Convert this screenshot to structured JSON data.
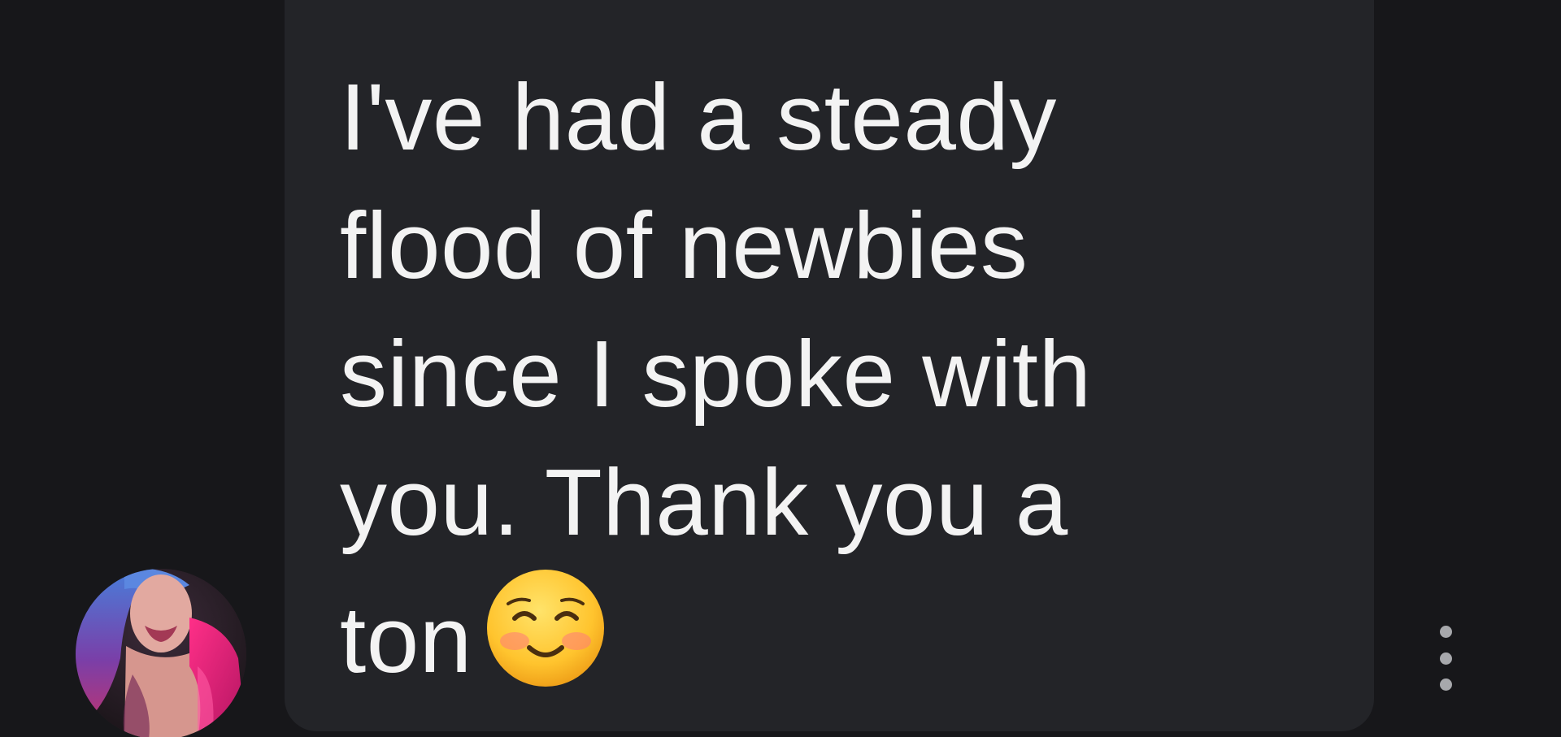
{
  "message": {
    "line1": "I've had a steady",
    "line2": "flood of newbies",
    "line3": "since I spoke with",
    "line4": "you. Thank you a",
    "line5": "ton",
    "emoji": "smiling-face-with-smiling-eyes-emoji"
  },
  "sender": {
    "avatar": "user-avatar-photo"
  },
  "actions": {
    "more_icon": "more-vert-icon"
  },
  "colors": {
    "background": "#17171a",
    "bubble": "#232428",
    "text": "#f3f3f3",
    "icon": "#a7a8ac"
  }
}
